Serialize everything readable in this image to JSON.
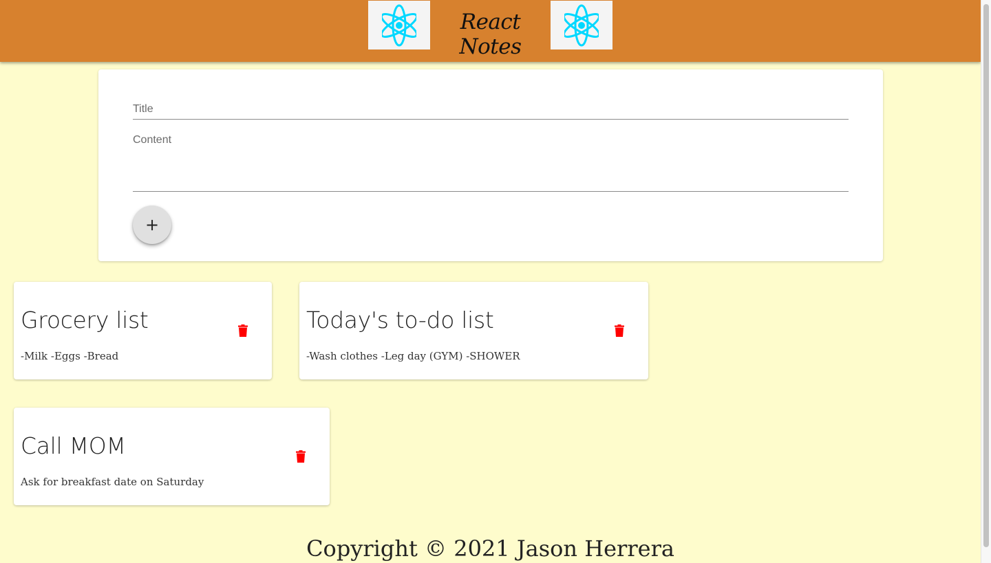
{
  "header": {
    "brand": "React Notes",
    "logo_icon": "react-atom-icon",
    "background": "#d7812e",
    "logo_color": "#00d8ff"
  },
  "form": {
    "title_placeholder": "Title",
    "content_placeholder": "Content",
    "add_button_label": "+"
  },
  "notes": [
    {
      "title": "Grocery list",
      "content": "-Milk -Eggs -Bread"
    },
    {
      "title": "Today's to-do list",
      "content": "-Wash clothes -Leg day (GYM) -SHOWER"
    },
    {
      "title": "Call MOM",
      "content": "Ask for breakfast date on Saturday"
    }
  ],
  "delete_icon": "trash-icon",
  "delete_color": "#ff0000",
  "footer": {
    "text": "Copyright © 2021 Jason Herrera"
  },
  "page_background": "#fefccc"
}
